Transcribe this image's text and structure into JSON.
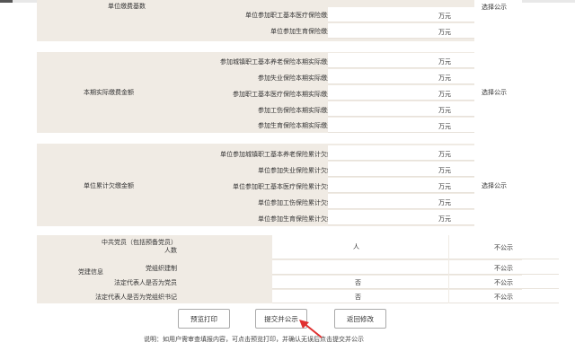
{
  "section_base": {
    "category": "单位缴费基数",
    "rows": [
      {
        "label": "单位参加职工基本医疗保险缴费基数",
        "unit": "万元"
      },
      {
        "label": "单位参加生育保险缴费基数",
        "unit": "万元"
      }
    ],
    "publish": "选择公示"
  },
  "section_actual": {
    "category": "本期实际缴费金额",
    "rows": [
      {
        "label": "参加城镇职工基本养老保险本期实际缴费金额",
        "unit": "万元"
      },
      {
        "label": "参加失业保险本期实际缴费金额",
        "unit": "万元"
      },
      {
        "label": "参加职工基本医疗保险本期实际缴费金额",
        "unit": "万元"
      },
      {
        "label": "参加工伤保险本期实际缴费金额",
        "unit": "万元"
      },
      {
        "label": "参加生育保险本期实际缴费金额",
        "unit": "万元"
      }
    ],
    "publish": "选择公示"
  },
  "section_arrears": {
    "category": "单位累计欠缴金额",
    "rows": [
      {
        "label": "单位参加城镇职工基本养老保险累计欠缴金额",
        "unit": "万元"
      },
      {
        "label": "单位参加失业保险累计欠缴金额",
        "unit": "万元"
      },
      {
        "label": "单位参加职工基本医疗保险累计欠缴金额",
        "unit": "万元"
      },
      {
        "label": "单位参加工伤保险累计欠缴金额",
        "unit": "万元"
      },
      {
        "label": "单位参加生育保险累计欠缴金额",
        "unit": "万元"
      }
    ],
    "publish": "选择公示"
  },
  "section_party": {
    "category": "党建信息",
    "rows": [
      {
        "label": "中共党员（包括预备党员）人数",
        "value": "人",
        "publish": "不公示"
      },
      {
        "label": "党组织建制",
        "value": "",
        "publish": "不公示"
      },
      {
        "label": "法定代表人是否为党员",
        "value": "否",
        "publish": "不公示"
      },
      {
        "label": "法定代表人是否为党组织书记",
        "value": "否",
        "publish": "不公示"
      }
    ]
  },
  "buttons": {
    "preview_print": "预览打印",
    "submit_publish": "提交并公示",
    "back_edit": "返回修改"
  },
  "note": "说明：如用户需审查填报内容，可点击预览打印，并确认无误后点击提交并公示",
  "colors": {
    "section_bg": "#f0ebe4",
    "arrow": "#e03030"
  }
}
